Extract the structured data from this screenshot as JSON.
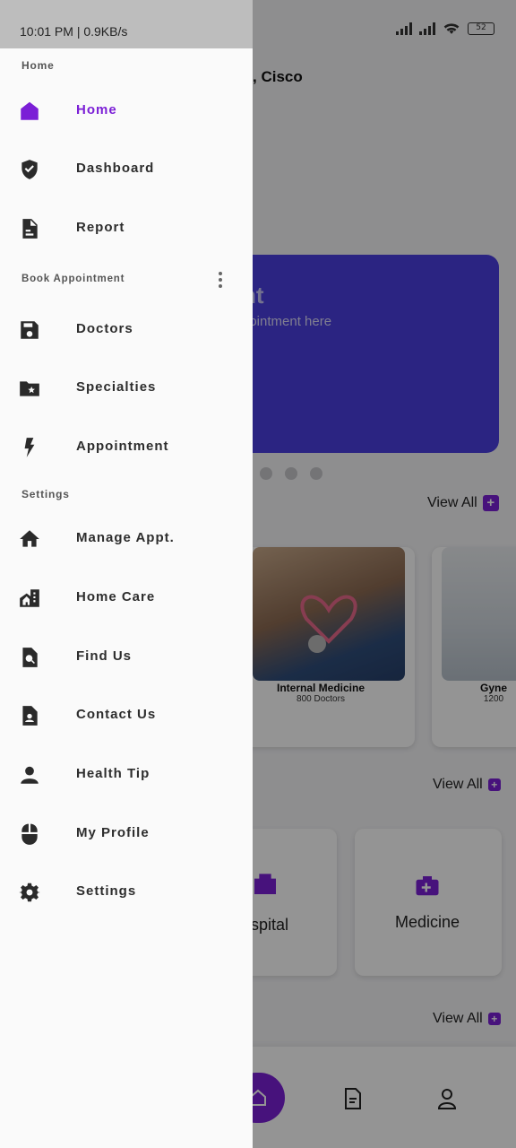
{
  "status_bar": {
    "time_speed": "10:01 PM | 0.9KB/s",
    "battery": "52"
  },
  "background": {
    "greeting": ", Cisco",
    "banner_title": "nt",
    "banner_subtitle": "pointment here",
    "view_all": "View All",
    "plus": "+",
    "specialties": [
      {
        "name": "Internal Medicine",
        "count": "800 Doctors"
      },
      {
        "name": "Gyne",
        "count": "1200"
      }
    ],
    "services": [
      {
        "name": "spital"
      },
      {
        "name": "Medicine"
      }
    ],
    "accent": "#7b1fd6",
    "banner_color": "#4a3fe0"
  },
  "drawer": {
    "sections": [
      {
        "title": "Home",
        "items": [
          {
            "label": "Home",
            "icon": "home-icon",
            "active": true
          },
          {
            "label": "Dashboard",
            "icon": "shield-check-icon"
          },
          {
            "label": "Report",
            "icon": "document-icon"
          }
        ]
      },
      {
        "title": "Book Appointment",
        "items": [
          {
            "label": "Doctors",
            "icon": "save-icon"
          },
          {
            "label": "Specialties",
            "icon": "folder-star-icon"
          },
          {
            "label": "Appointment",
            "icon": "lightning-icon"
          }
        ]
      },
      {
        "title": "Settings",
        "items": [
          {
            "label": "Manage Appt.",
            "icon": "house-icon"
          },
          {
            "label": "Home Care",
            "icon": "home-building-icon"
          },
          {
            "label": "Find Us",
            "icon": "find-in-page-icon"
          },
          {
            "label": "Contact Us",
            "icon": "contact-card-icon"
          },
          {
            "label": "Health Tip",
            "icon": "person-icon"
          },
          {
            "label": "My Profile",
            "icon": "mouse-icon"
          },
          {
            "label": "Settings",
            "icon": "gear-icon"
          }
        ]
      }
    ]
  }
}
